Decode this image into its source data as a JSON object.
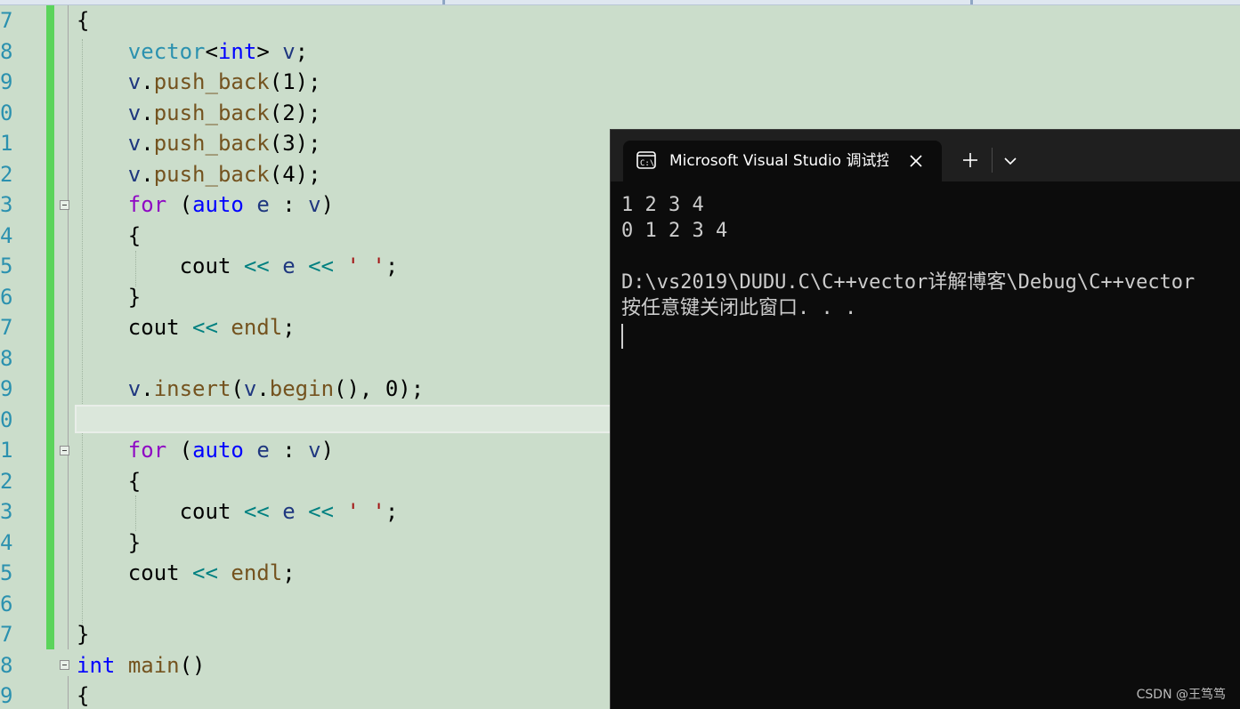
{
  "editor": {
    "lines": [
      {
        "num": "7",
        "code": [
          {
            "t": "{",
            "c": ""
          }
        ]
      },
      {
        "num": "8",
        "code": [
          {
            "t": "    ",
            "c": ""
          },
          {
            "t": "vector",
            "c": "ty"
          },
          {
            "t": "<",
            "c": ""
          },
          {
            "t": "int",
            "c": "kw"
          },
          {
            "t": "> ",
            "c": ""
          },
          {
            "t": "v",
            "c": "var"
          },
          {
            "t": ";",
            "c": ""
          }
        ]
      },
      {
        "num": "9",
        "code": [
          {
            "t": "    ",
            "c": ""
          },
          {
            "t": "v",
            "c": "var"
          },
          {
            "t": ".",
            "c": ""
          },
          {
            "t": "push_back",
            "c": "fn"
          },
          {
            "t": "(1);",
            "c": ""
          }
        ]
      },
      {
        "num": "0",
        "code": [
          {
            "t": "    ",
            "c": ""
          },
          {
            "t": "v",
            "c": "var"
          },
          {
            "t": ".",
            "c": ""
          },
          {
            "t": "push_back",
            "c": "fn"
          },
          {
            "t": "(2);",
            "c": ""
          }
        ]
      },
      {
        "num": "1",
        "code": [
          {
            "t": "    ",
            "c": ""
          },
          {
            "t": "v",
            "c": "var"
          },
          {
            "t": ".",
            "c": ""
          },
          {
            "t": "push_back",
            "c": "fn"
          },
          {
            "t": "(3);",
            "c": ""
          }
        ]
      },
      {
        "num": "2",
        "code": [
          {
            "t": "    ",
            "c": ""
          },
          {
            "t": "v",
            "c": "var"
          },
          {
            "t": ".",
            "c": ""
          },
          {
            "t": "push_back",
            "c": "fn"
          },
          {
            "t": "(4);",
            "c": ""
          }
        ]
      },
      {
        "num": "3",
        "code": [
          {
            "t": "    ",
            "c": ""
          },
          {
            "t": "for",
            "c": "kw2"
          },
          {
            "t": " (",
            "c": ""
          },
          {
            "t": "auto",
            "c": "kw"
          },
          {
            "t": " ",
            "c": ""
          },
          {
            "t": "e",
            "c": "var"
          },
          {
            "t": " : ",
            "c": ""
          },
          {
            "t": "v",
            "c": "var"
          },
          {
            "t": ")",
            "c": ""
          }
        ]
      },
      {
        "num": "4",
        "code": [
          {
            "t": "    {",
            "c": ""
          }
        ]
      },
      {
        "num": "5",
        "code": [
          {
            "t": "        cout ",
            "c": ""
          },
          {
            "t": "<<",
            "c": "op"
          },
          {
            "t": " ",
            "c": ""
          },
          {
            "t": "e",
            "c": "var"
          },
          {
            "t": " ",
            "c": ""
          },
          {
            "t": "<<",
            "c": "op"
          },
          {
            "t": " ",
            "c": ""
          },
          {
            "t": "' '",
            "c": "str"
          },
          {
            "t": ";",
            "c": ""
          }
        ]
      },
      {
        "num": "6",
        "code": [
          {
            "t": "    }",
            "c": ""
          }
        ]
      },
      {
        "num": "7",
        "code": [
          {
            "t": "    cout ",
            "c": ""
          },
          {
            "t": "<<",
            "c": "op"
          },
          {
            "t": " ",
            "c": ""
          },
          {
            "t": "endl",
            "c": "fn"
          },
          {
            "t": ";",
            "c": ""
          }
        ]
      },
      {
        "num": "8",
        "code": []
      },
      {
        "num": "9",
        "code": [
          {
            "t": "    ",
            "c": ""
          },
          {
            "t": "v",
            "c": "var"
          },
          {
            "t": ".",
            "c": ""
          },
          {
            "t": "insert",
            "c": "fn"
          },
          {
            "t": "(",
            "c": ""
          },
          {
            "t": "v",
            "c": "var"
          },
          {
            "t": ".",
            "c": ""
          },
          {
            "t": "begin",
            "c": "fn"
          },
          {
            "t": "(), 0);",
            "c": ""
          }
        ]
      },
      {
        "num": "0",
        "code": []
      },
      {
        "num": "1",
        "code": [
          {
            "t": "    ",
            "c": ""
          },
          {
            "t": "for",
            "c": "kw2"
          },
          {
            "t": " (",
            "c": ""
          },
          {
            "t": "auto",
            "c": "kw"
          },
          {
            "t": " ",
            "c": ""
          },
          {
            "t": "e",
            "c": "var"
          },
          {
            "t": " : ",
            "c": ""
          },
          {
            "t": "v",
            "c": "var"
          },
          {
            "t": ")",
            "c": ""
          }
        ]
      },
      {
        "num": "2",
        "code": [
          {
            "t": "    {",
            "c": ""
          }
        ]
      },
      {
        "num": "3",
        "code": [
          {
            "t": "        cout ",
            "c": ""
          },
          {
            "t": "<<",
            "c": "op"
          },
          {
            "t": " ",
            "c": ""
          },
          {
            "t": "e",
            "c": "var"
          },
          {
            "t": " ",
            "c": ""
          },
          {
            "t": "<<",
            "c": "op"
          },
          {
            "t": " ",
            "c": ""
          },
          {
            "t": "' '",
            "c": "str"
          },
          {
            "t": ";",
            "c": ""
          }
        ]
      },
      {
        "num": "4",
        "code": [
          {
            "t": "    }",
            "c": ""
          }
        ]
      },
      {
        "num": "5",
        "code": [
          {
            "t": "    cout ",
            "c": ""
          },
          {
            "t": "<<",
            "c": "op"
          },
          {
            "t": " ",
            "c": ""
          },
          {
            "t": "endl",
            "c": "fn"
          },
          {
            "t": ";",
            "c": ""
          }
        ]
      },
      {
        "num": "6",
        "code": []
      },
      {
        "num": "7",
        "code": [
          {
            "t": "}",
            "c": ""
          }
        ]
      },
      {
        "num": "8",
        "code": [
          {
            "t": "int",
            "c": "kw"
          },
          {
            "t": " ",
            "c": ""
          },
          {
            "t": "main",
            "c": "fn"
          },
          {
            "t": "()",
            "c": ""
          }
        ]
      },
      {
        "num": "9",
        "code": [
          {
            "t": "{",
            "c": ""
          }
        ]
      }
    ]
  },
  "terminal": {
    "tab_title": "Microsoft Visual Studio 调试控制台",
    "tab_icon": "console-icon",
    "close_icon": "close-icon",
    "new_tab_icon": "plus-icon",
    "dropdown_icon": "chevron-down-icon",
    "output": [
      "1 2 3 4",
      "0 1 2 3 4",
      "",
      "D:\\vs2019\\DUDU.C\\C++vector详解博客\\Debug\\C++vector",
      "按任意键关闭此窗口. . ."
    ]
  },
  "watermark": "CSDN @王笃笃",
  "colors": {
    "editor_bg": "#cbddcb",
    "line_number": "#2b91af",
    "keyword": "#0000ff",
    "control_keyword": "#8f08c4",
    "function": "#74531f",
    "variable": "#1f377f",
    "operator": "#008080",
    "string": "#a31515",
    "change_bar": "#5bd45b",
    "terminal_bg": "#0c0c0c"
  }
}
